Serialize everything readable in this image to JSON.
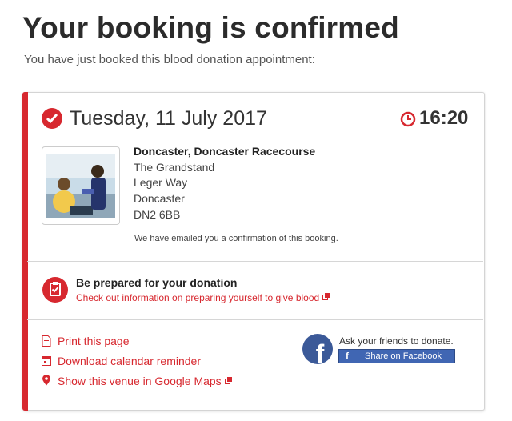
{
  "page": {
    "title": "Your booking is confirmed",
    "subtitle": "You have just booked this blood donation appointment:"
  },
  "appointment": {
    "date": "Tuesday, 11 July 2017",
    "time": "16:20",
    "venue": {
      "name": "Doncaster, Doncaster Racecourse",
      "line1": "The Grandstand",
      "line2": "Leger Way",
      "line3": "Doncaster",
      "postcode": "DN2 6BB"
    },
    "email_note": "We have emailed you a confirmation of this booking."
  },
  "prepare": {
    "title": "Be prepared for your donation",
    "link": "Check out information on preparing yourself to give blood"
  },
  "actions": {
    "print": "Print this page",
    "calendar": "Download calendar reminder",
    "maps": "Show this venue in Google Maps"
  },
  "social": {
    "ask": "Ask your friends to donate.",
    "share_button": "Share on Facebook"
  },
  "colors": {
    "accent": "#d7282f",
    "facebook": "#3b5998"
  }
}
